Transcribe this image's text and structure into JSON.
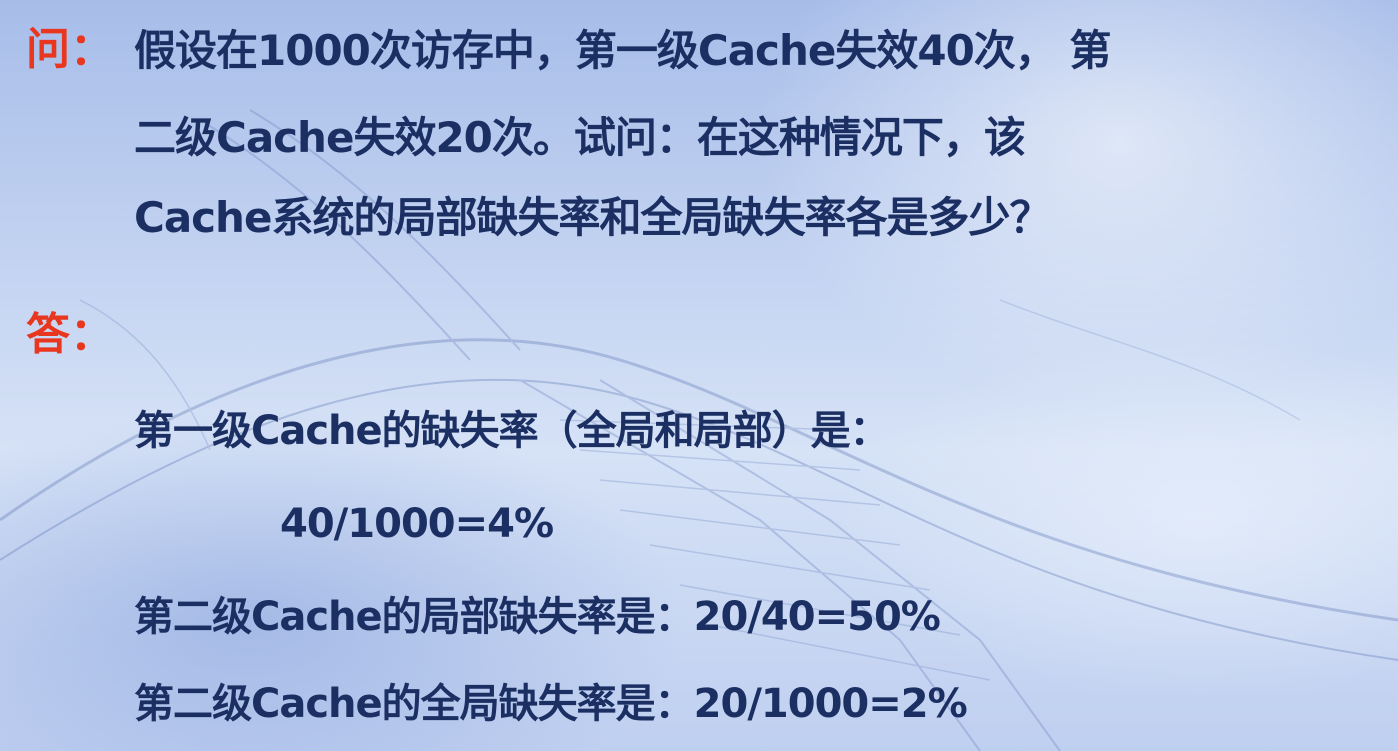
{
  "question": {
    "label": "问：",
    "lines": [
      "假设在1000次访存中，第一级Cache失效40次， 第",
      "二级Cache失效20次。试问：在这种情况下，该",
      "Cache系统的局部缺失率和全局缺失率各是多少？"
    ]
  },
  "answer": {
    "label": "答：",
    "lines": [
      "第一级Cache的缺失率（全局和局部）是：",
      "40/1000=4%",
      "第二级Cache的局部缺失率是：20/40=50%",
      "第二级Cache的全局缺失率是：20/1000=2%"
    ]
  },
  "colors": {
    "label": "#e8361f",
    "text": "#1b2f63",
    "background": "#c3d3f1"
  }
}
